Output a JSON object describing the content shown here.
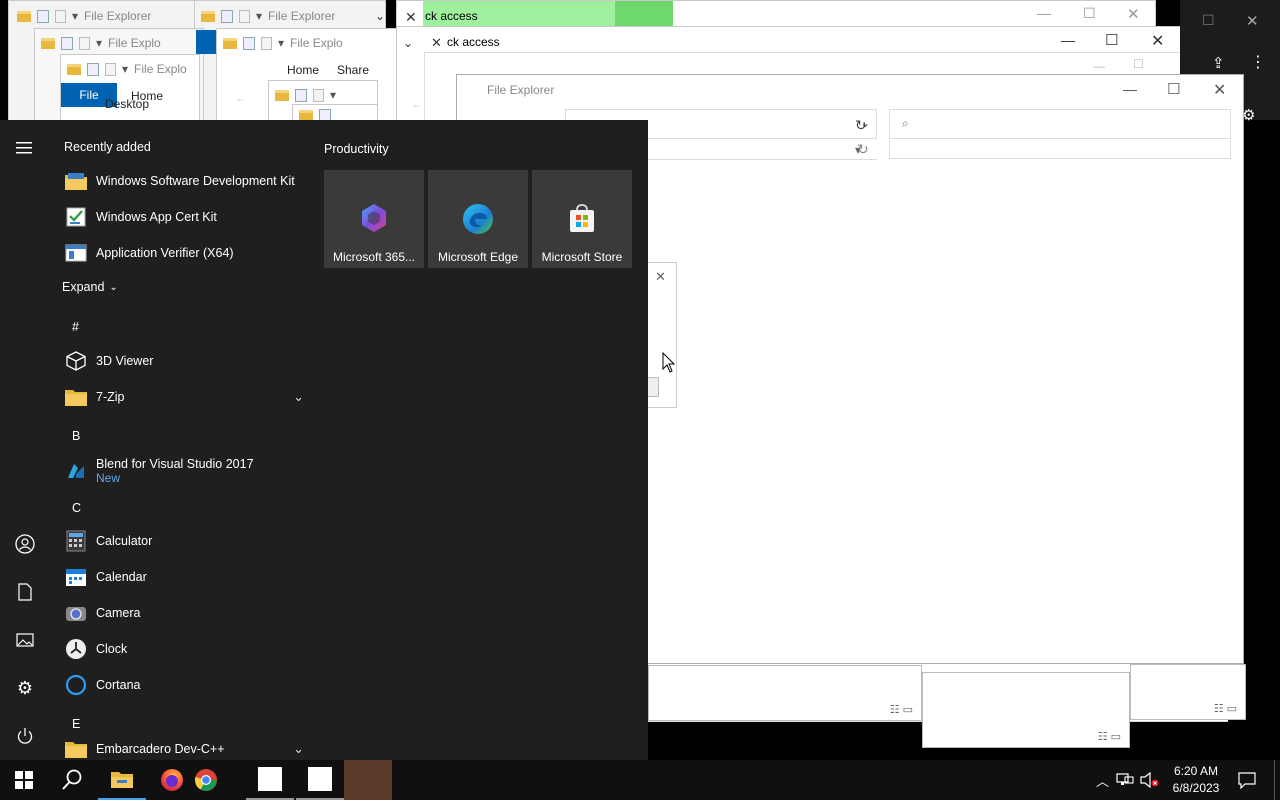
{
  "background_windows": {
    "file_explorer_title": "File Explorer",
    "file_explorer_title_short": "File Explo",
    "file_explorer_title_short2": "File Explorer",
    "quick_access_title_1": "ck access",
    "quick_access_title_2": "ck access",
    "ribbon_file_tab": "File",
    "ribbon_home_tab": "Home",
    "ribbon_home_tab_2": "Home",
    "ribbon_share_tab": "Share",
    "desktop_label": "Desktop",
    "front_title": "File Explorer",
    "front_title_fade": "File Explo"
  },
  "start_menu": {
    "recently_added_heading": "Recently added",
    "recently_added": [
      {
        "label": "Windows Software Development Kit",
        "icon": "folder-sdk-icon"
      },
      {
        "label": "Windows App Cert Kit",
        "icon": "cert-kit-icon"
      },
      {
        "label": "Application Verifier (X64)",
        "icon": "app-verifier-icon"
      }
    ],
    "expand_label": "Expand",
    "letters": {
      "hash": "#",
      "b": "B",
      "c": "C",
      "e": "E"
    },
    "apps": {
      "viewer3d": "3D Viewer",
      "sevenzip": "7-Zip",
      "blend": "Blend for Visual Studio 2017",
      "blend_badge": "New",
      "calculator": "Calculator",
      "calendar": "Calendar",
      "camera": "Camera",
      "clock": "Clock",
      "cortana": "Cortana",
      "embarcadero": "Embarcadero Dev-C++"
    },
    "productivity_heading": "Productivity",
    "tiles": [
      {
        "label": "Microsoft 365...",
        "icon": "microsoft-365-icon"
      },
      {
        "label": "Microsoft Edge",
        "icon": "edge-icon"
      },
      {
        "label": "Microsoft Store",
        "icon": "store-icon"
      }
    ]
  },
  "taskbar": {
    "clock_time": "6:20 AM",
    "clock_date": "6/8/2023"
  },
  "colors": {
    "start_bg": "#1f1f1f",
    "accent_blue": "#0063b1",
    "taskbar_bg": "#101010",
    "active_task": "#5b3a29"
  }
}
